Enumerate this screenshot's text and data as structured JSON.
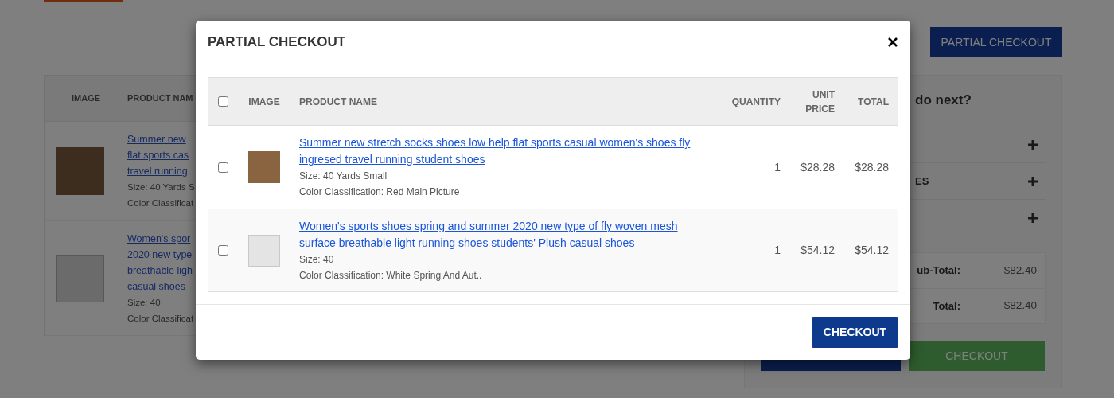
{
  "page": {
    "partial_checkout_button": "PARTIAL CHECKOUT",
    "cart_table": {
      "columns": [
        "IMAGE",
        "PRODUCT NAM"
      ],
      "rows": [
        {
          "name_lines": [
            "Summer new",
            "flat sports cas",
            "travel running"
          ],
          "size": "Size: 40 Yards S",
          "color_classification": "Color Classificat"
        },
        {
          "name_lines": [
            "Women's spor",
            "2020 new type",
            "breathable ligh",
            "casual shoes"
          ],
          "size": "Size: 40",
          "color_classification": "Color Classificat"
        }
      ]
    },
    "summary": {
      "heading": "do next?",
      "sections": [
        {
          "expanded": false
        },
        {
          "title": "ES",
          "expanded": false
        },
        {
          "expanded": false
        }
      ],
      "totals": [
        {
          "label": "ub-Total:",
          "value": "$82.40"
        },
        {
          "label": "Total:",
          "value": "$82.40"
        }
      ],
      "checkout_button": "CHECKOUT"
    }
  },
  "modal": {
    "title": "PARTIAL CHECKOUT",
    "select_all": {
      "checked": false
    },
    "columns": [
      "IMAGE",
      "PRODUCT NAME",
      "QUANTITY",
      "UNIT PRICE",
      "TOTAL"
    ],
    "rows": [
      {
        "checked": false,
        "name": "Summer new stretch socks shoes low help flat sports casual women's shoes fly ingresed travel running student shoes",
        "size": "Size: 40 Yards Small",
        "color_classification": "Color Classification: Red Main Picture",
        "quantity": "1",
        "unit_price": "$28.28",
        "total": "$28.28"
      },
      {
        "checked": false,
        "name": "Women's sports shoes spring and summer 2020 new type of fly woven mesh surface breathable light running shoes students' Plush casual shoes",
        "size": "Size: 40",
        "color_classification": "Color Classification: White Spring And Aut..",
        "quantity": "1",
        "unit_price": "$54.12",
        "total": "$54.12"
      }
    ],
    "checkout_button": "CHECKOUT"
  }
}
